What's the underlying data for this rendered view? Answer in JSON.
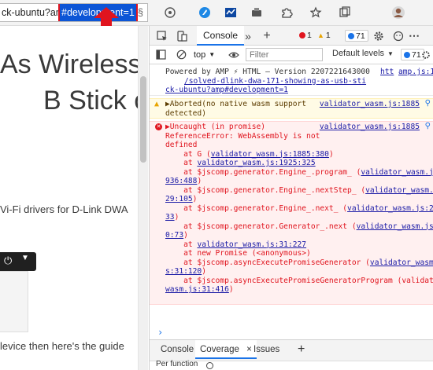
{
  "browser": {
    "url_start": "ck-ubuntu?am",
    "url_highlight": "#development=1",
    "url_end": "§",
    "toolbar_icons": [
      "translate-icon",
      "extension-icon",
      "extension-icon",
      "extension-icon",
      "puzzle-icon",
      "favorites-star-icon",
      "collections-icon",
      "profile-avatar"
    ]
  },
  "page": {
    "headline_line1": "As Wireless",
    "headline_line2": "B Stick on",
    "paragraph_line": "Vi-Fi drivers for D-Link DWA",
    "bottom_line": "levice then here's the guide",
    "power_label": "⏻"
  },
  "devtools": {
    "tabs": {
      "console": "Console",
      "more": "»",
      "add": "+"
    },
    "errors_count": "1",
    "warnings_count": "1",
    "messages_count": "71",
    "context": "top",
    "filter_placeholder": "Filter",
    "levels_label": "Default levels",
    "issues_count": "71",
    "console": {
      "info_lines": [
        "Powered by AMP ⚡ HTML – Version 2207221643000",
        "ck-ubuntu?amp#development=1"
      ],
      "info_link_inline": "htt",
      "info_link_source": "amp.js:147",
      "info_link_line2": "/solved-dlink-dwa-171-showing-as-usb-sti",
      "warn_lines": [
        "▶Aborted(no native wasm support",
        "detected)"
      ],
      "warn_source": "validator_wasm.js:1885",
      "err_header": "▶Uncaught (in promise)",
      "err_source": "validator_wasm.js:1885",
      "err_lines": [
        "ReferenceError: WebAssembly is not",
        "defined",
        "    at G (validator_wasm.js:1885:380)",
        "    at validator_wasm.js:1925:325",
        "    at $jscomp.generator.Engine_.program_ (validator_wasm.js:1",
        "936:488)",
        "    at $jscomp.generator.Engine_.nextStep_ (validator_wasm.js:1",
        "29:105)",
        "    at $jscomp.generator.Engine_.next_ (validator_wasm.js:25:3",
        "33)",
        "    at $jscomp.generator.Generator_.next (validator_wasm.js:3",
        "0:73)",
        "    at validator_wasm.js:31:227",
        "    at new Promise (<anonymous>)",
        "    at $jscomp.asyncExecutePromiseGenerator (validator_wasm.j",
        "s:31:120)",
        "    at $jscomp.asyncExecutePromiseGeneratorProgram (validator_",
        "wasm.js:31:416)"
      ],
      "prompt": "›"
    },
    "drawer": {
      "tabs": [
        "Console",
        "Coverage",
        "Issues"
      ],
      "close": "×",
      "add": "+",
      "tool_label": "Per function"
    }
  },
  "colors": {
    "highlight_bg": "#0c55d6",
    "highlight_border": "#e0141e",
    "error": "#e0141e",
    "warning": "#e8a400",
    "accent": "#1a73e8"
  }
}
